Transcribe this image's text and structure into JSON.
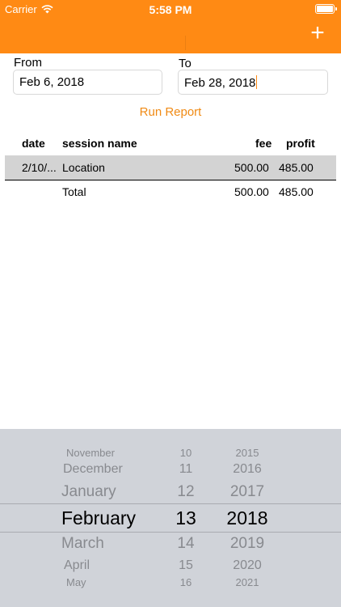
{
  "status_bar": {
    "carrier": "Carrier",
    "time": "5:58 PM"
  },
  "nav": {
    "add_label": "+"
  },
  "form": {
    "from_label": "From",
    "from_value": "Feb 6, 2018",
    "to_label": "To",
    "to_value": "Feb 28, 2018",
    "run_report_label": "Run Report"
  },
  "table": {
    "headers": {
      "date": "date",
      "session": "session name",
      "fee": "fee",
      "profit": "profit"
    },
    "rows": [
      {
        "date": "2/10/...",
        "session": "Location",
        "fee": "500.00",
        "profit": "485.00"
      }
    ],
    "total": {
      "label": "Total",
      "fee": "500.00",
      "profit": "485.00"
    }
  },
  "picker": {
    "months": [
      "November",
      "December",
      "January",
      "February",
      "March",
      "April",
      "May"
    ],
    "days": [
      "10",
      "11",
      "12",
      "13",
      "14",
      "15",
      "16"
    ],
    "years": [
      "2015",
      "2016",
      "2017",
      "2018",
      "2019",
      "2020",
      "2021"
    ],
    "selected_month": "February",
    "selected_day": "13",
    "selected_year": "2018"
  },
  "colors": {
    "accent": "#ff8a14",
    "picker_bg": "#d0d3d9",
    "selected_row": "#d3d3d3"
  }
}
